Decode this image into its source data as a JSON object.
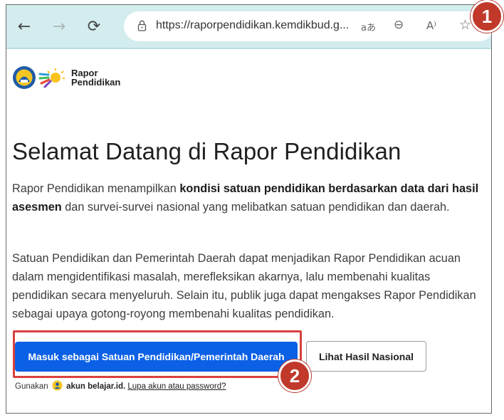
{
  "browser": {
    "url": "https://raporpendidikan.kemdikbud.g...",
    "read_aloud_label": "aあ",
    "font_size_label": "A⁾"
  },
  "header": {
    "logo_line1": "Rapor",
    "logo_line2": "Pendidikan"
  },
  "main": {
    "title": "Selamat Datang di Rapor Pendidikan",
    "intro": {
      "part1": "Rapor Pendidikan menampilkan ",
      "bold": "kondisi satuan pendidikan berdasarkan data dari hasil asesmen",
      "part2": " dan survei-survei nasional yang melibatkan satuan pendidikan dan daerah."
    },
    "paragraph2": "Satuan Pendidikan dan Pemerintah Daerah dapat menjadikan Rapor Pendidikan acuan dalam mengidentifikasi masalah, merefleksikan akarnya, lalu membenahi kualitas pendidikan secara menyeluruh. Selain itu, publik juga dapat mengakses Rapor Pendidikan sebagai upaya gotong-royong membenahi kualitas pendidikan.",
    "primary_button": "Masuk sebagai Satuan Pendidikan/Pemerintah Daerah",
    "secondary_button": "Lihat Hasil Nasional",
    "login_prefix": "Gunakan",
    "login_brand": "akun belajar.id.",
    "forgot_link": "Lupa akun atau password?"
  },
  "callouts": {
    "first": "1",
    "second": "2"
  },
  "colors": {
    "primary": "#0b60e6",
    "callout": "#c0392b",
    "highlight": "#d8413f",
    "toolbar": "#d3ecee"
  }
}
